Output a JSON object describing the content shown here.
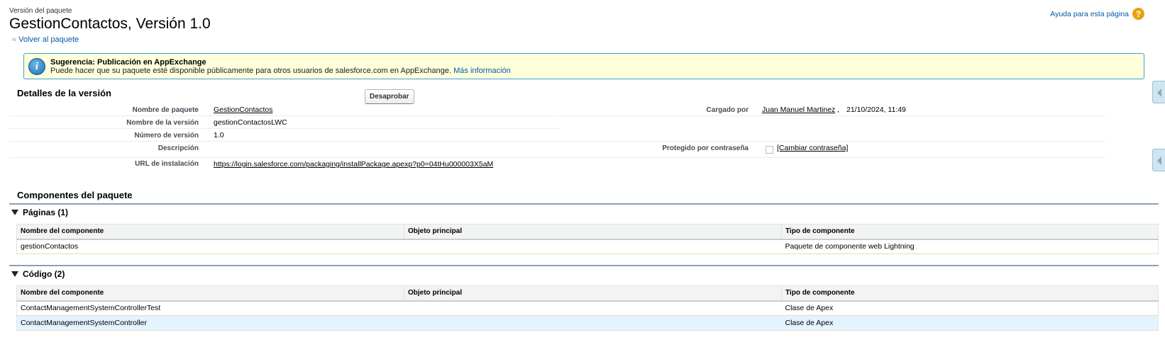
{
  "header": {
    "type_label": "Versión del paquete",
    "title": "GestionContactos, Versión 1.0",
    "back_link": "Volver al paquete",
    "back_prefix": "«",
    "help_link": "Ayuda para esta página",
    "help_icon": "?"
  },
  "tip": {
    "icon": "i",
    "title": "Sugerencia: Publicación en AppExchange",
    "body": "Puede hacer que su paquete esté disponible públicamente para otros usuarios de salesforce.com en AppExchange.",
    "link": "Más información"
  },
  "details": {
    "section_title": "Detalles de la versión",
    "deprecate_button": "Desaprobar",
    "fields": {
      "package_name_label": "Nombre de paquete",
      "package_name_value": "GestionContactos",
      "version_name_label": "Nombre de la versión",
      "version_name_value": "gestionContactosLWC",
      "version_number_label": "Número de versión",
      "version_number_value": "1.0",
      "description_label": "Descripción",
      "description_value": "",
      "install_url_label": "URL de instalación",
      "install_url_value": "https://login.salesforce.com/packaging/installPackage.apexp?p0=04tHu000003X5aM",
      "uploaded_by_label": "Cargado por",
      "uploaded_by_user": "Juan Manuel Martinez",
      "uploaded_by_date": "21/10/2024, 11:49",
      "password_label": "Protegido por contraseña",
      "password_link": "[Cambiar contraseña]"
    }
  },
  "components": {
    "section_title": "Componentes del paquete",
    "columns": [
      "Nombre del componente",
      "Objeto principal",
      "Tipo de componente"
    ],
    "pages": {
      "title": "Páginas (1)",
      "rows": [
        [
          "gestionContactos",
          "",
          "Paquete de componente web Lightning"
        ]
      ]
    },
    "code": {
      "title": "Código (2)",
      "rows": [
        [
          "ContactManagementSystemControllerTest",
          "",
          "Clase de Apex"
        ],
        [
          "ContactManagementSystemController",
          "",
          "Clase de Apex"
        ]
      ]
    }
  },
  "colors": {
    "link": "#015ba7",
    "tip_background": "#ffffdc",
    "tip_border": "#39a3d8",
    "section_rule": "#8e9dbe",
    "row_highlight": "#e3f3ff"
  }
}
